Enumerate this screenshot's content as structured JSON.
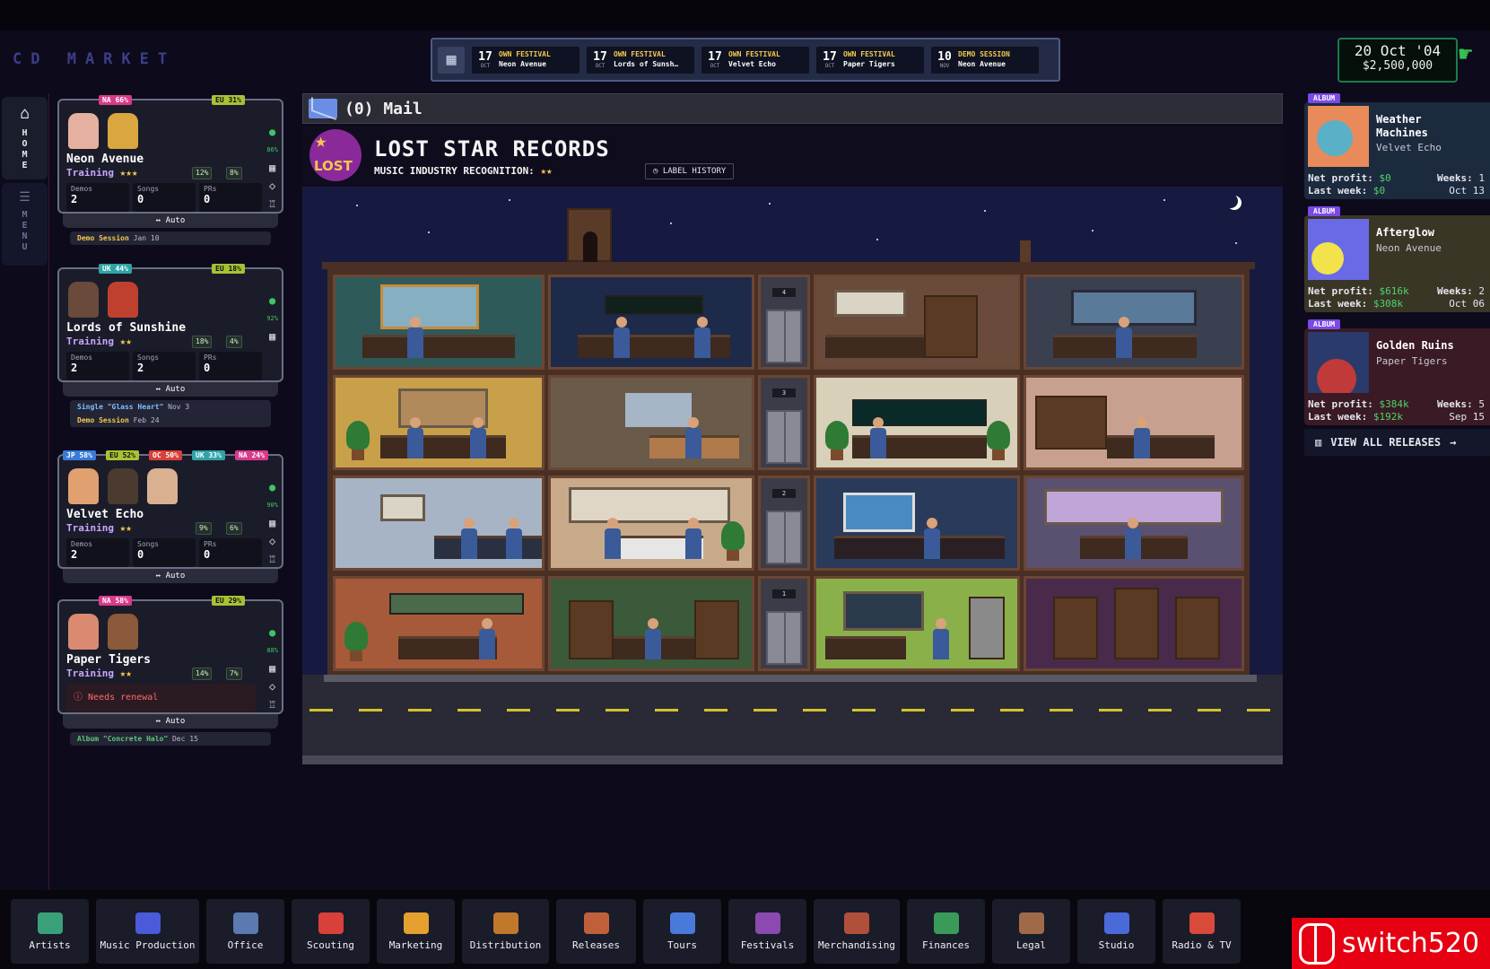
{
  "app": {
    "title": "CD MARKET"
  },
  "events": [
    {
      "day": "17",
      "month": "OCT",
      "type": "OWN FESTIVAL",
      "name": "Neon Avenue"
    },
    {
      "day": "17",
      "month": "OCT",
      "type": "OWN FESTIVAL",
      "name": "Lords of Sunsh…"
    },
    {
      "day": "17",
      "month": "OCT",
      "type": "OWN FESTIVAL",
      "name": "Velvet Echo"
    },
    {
      "day": "17",
      "month": "OCT",
      "type": "OWN FESTIVAL",
      "name": "Paper Tigers"
    },
    {
      "day": "10",
      "month": "NOV",
      "type": "DEMO SESSION",
      "name": "Neon Avenue"
    }
  ],
  "status": {
    "date": "20 Oct '04",
    "money": "$2,500,000"
  },
  "side_nav": {
    "home": "HOME",
    "menu": "MENU"
  },
  "artists": [
    {
      "name": "Neon Avenue",
      "training_label": "Training",
      "stars": "★★★",
      "tags": [
        "NA 66%",
        "EU 31%"
      ],
      "pct_a": "12%",
      "pct_b": "8%",
      "bulb": "86%",
      "demos_label": "Demos",
      "demos": "2",
      "songs_label": "Songs",
      "songs": "0",
      "prs_label": "PRs",
      "prs": "0",
      "auto": "Auto",
      "notes": [
        {
          "name": "Demo Session",
          "date": "Jan 10"
        }
      ]
    },
    {
      "name": "Lords of Sunshine",
      "training_label": "Training",
      "stars": "★★",
      "tags": [
        "UK 44%",
        "EU 18%"
      ],
      "pct_a": "18%",
      "pct_b": "4%",
      "bulb": "92%",
      "demos_label": "Demos",
      "demos": "2",
      "songs_label": "Songs",
      "songs": "2",
      "prs_label": "PRs",
      "prs": "0",
      "auto": "Auto",
      "notes": [
        {
          "name": "Single \"Glass Heart\"",
          "date": "Nov 3"
        },
        {
          "name": "Demo Session",
          "date": "Feb 24"
        }
      ]
    },
    {
      "name": "Velvet Echo",
      "training_label": "Training",
      "stars": "★★",
      "tags": [
        "JP 58%",
        "EU 52%",
        "OC 50%",
        "UK 33%",
        "NA 24%"
      ],
      "pct_a": "9%",
      "pct_b": "6%",
      "bulb": "90%",
      "demos_label": "Demos",
      "demos": "2",
      "songs_label": "Songs",
      "songs": "0",
      "prs_label": "PRs",
      "prs": "0",
      "auto": "Auto",
      "notes": []
    },
    {
      "name": "Paper Tigers",
      "training_label": "Training",
      "stars": "★★",
      "tags": [
        "NA 58%",
        "EU 29%"
      ],
      "pct_a": "14%",
      "pct_b": "7%",
      "bulb": "88%",
      "renewal": "Needs renewal",
      "auto": "Auto",
      "notes": [
        {
          "name": "Album \"Concrete Halo\"",
          "date": "Dec 15"
        }
      ]
    }
  ],
  "mail": {
    "label": "(0) Mail"
  },
  "label": {
    "logo_text": "LOST",
    "title": "LOST STAR RECORDS",
    "recognition": "MUSIC INDUSTRY RECOGNITION:",
    "recognition_stars": "★★",
    "history_button": "LABEL HISTORY"
  },
  "floor_numbers": [
    "4",
    "3",
    "2",
    "1"
  ],
  "releases": [
    {
      "tag": "ALBUM",
      "title": "Weather Machines",
      "artist": "Velvet Echo",
      "net_label": "Net profit:",
      "net": "$0",
      "weeks_label": "Weeks:",
      "weeks": "1",
      "last_label": "Last week:",
      "last": "$0",
      "date": "Oct 13"
    },
    {
      "tag": "ALBUM",
      "title": "Afterglow",
      "artist": "Neon Avenue",
      "net_label": "Net profit:",
      "net": "$616k",
      "weeks_label": "Weeks:",
      "weeks": "2",
      "last_label": "Last week:",
      "last": "$308k",
      "date": "Oct 06"
    },
    {
      "tag": "ALBUM",
      "title": "Golden Ruins",
      "artist": "Paper Tigers",
      "net_label": "Net profit:",
      "net": "$384k",
      "weeks_label": "Weeks:",
      "weeks": "5",
      "last_label": "Last week:",
      "last": "$192k",
      "date": "Sep 15"
    }
  ],
  "view_all": "VIEW ALL RELEASES",
  "bottom_nav": [
    {
      "label": "Artists",
      "icon": "artists-icon",
      "color": "#3aa07a"
    },
    {
      "label": "Music Production",
      "icon": "music-production-icon",
      "color": "#4a5ad9"
    },
    {
      "label": "Office",
      "icon": "office-icon",
      "color": "#5a7ab0"
    },
    {
      "label": "Scouting",
      "icon": "scouting-icon",
      "color": "#d9403a"
    },
    {
      "label": "Marketing",
      "icon": "marketing-icon",
      "color": "#e6a030"
    },
    {
      "label": "Distribution",
      "icon": "distribution-icon",
      "color": "#c0782a"
    },
    {
      "label": "Releases",
      "icon": "releases-icon",
      "color": "#c0603a"
    },
    {
      "label": "Tours",
      "icon": "tours-icon",
      "color": "#4a7ad9"
    },
    {
      "label": "Festivals",
      "icon": "festivals-icon",
      "color": "#8a4ab0"
    },
    {
      "label": "Merchandising",
      "icon": "merchandising-icon",
      "color": "#b0503a"
    },
    {
      "label": "Finances",
      "icon": "finances-icon",
      "color": "#3a9a5a"
    },
    {
      "label": "Legal",
      "icon": "legal-icon",
      "color": "#a06a4a"
    },
    {
      "label": "Studio",
      "icon": "studio-icon",
      "color": "#4a6ad9"
    },
    {
      "label": "Radio & TV",
      "icon": "radio-tv-icon",
      "color": "#d94a3a"
    }
  ],
  "watermark": "switch520",
  "colors": {
    "accent_green": "#4bd66a",
    "gold": "#f2c94c",
    "album_tag": "#7a4ae6"
  }
}
